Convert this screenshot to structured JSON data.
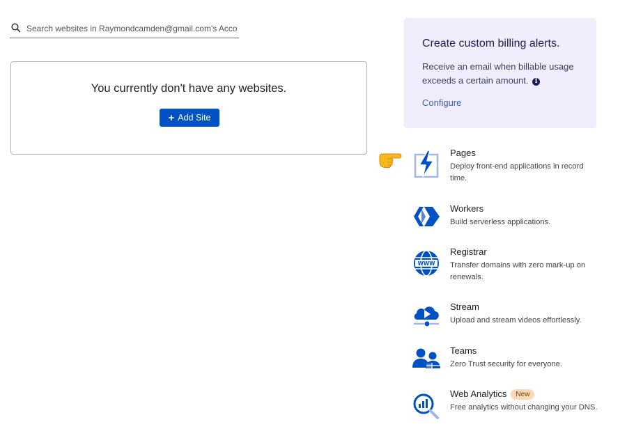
{
  "search": {
    "placeholder": "Search websites in Raymondcamden@gmail.com's Account",
    "value": ""
  },
  "empty_state": {
    "message": "You currently don't have any websites.",
    "add_button_label": "Add Site"
  },
  "billing_alert": {
    "title": "Create custom billing alerts.",
    "body": "Receive an email when billable usage exceeds a certain amount.",
    "link_label": "Configure"
  },
  "products": [
    {
      "name": "Pages",
      "description": "Deploy front-end applications in record time.",
      "icon": "pages-icon"
    },
    {
      "name": "Workers",
      "description": "Build serverless applications.",
      "icon": "workers-icon"
    },
    {
      "name": "Registrar",
      "description": "Transfer domains with zero mark-up on renewals.",
      "icon": "registrar-globe-icon"
    },
    {
      "name": "Stream",
      "description": "Upload and stream videos effortlessly.",
      "icon": "stream-cloud-icon"
    },
    {
      "name": "Teams",
      "description": "Zero Trust security for everyone.",
      "icon": "teams-icon"
    },
    {
      "name": "Web Analytics",
      "description": "Free analytics without changing your DNS.",
      "icon": "web-analytics-icon",
      "badge": "New"
    }
  ],
  "colors": {
    "primary_button": "#0051c3",
    "icon_blue": "#0051c3",
    "alert_bg": "#f0eefc",
    "link": "#3c5bbf",
    "badge_bg": "#fcd9b6"
  }
}
